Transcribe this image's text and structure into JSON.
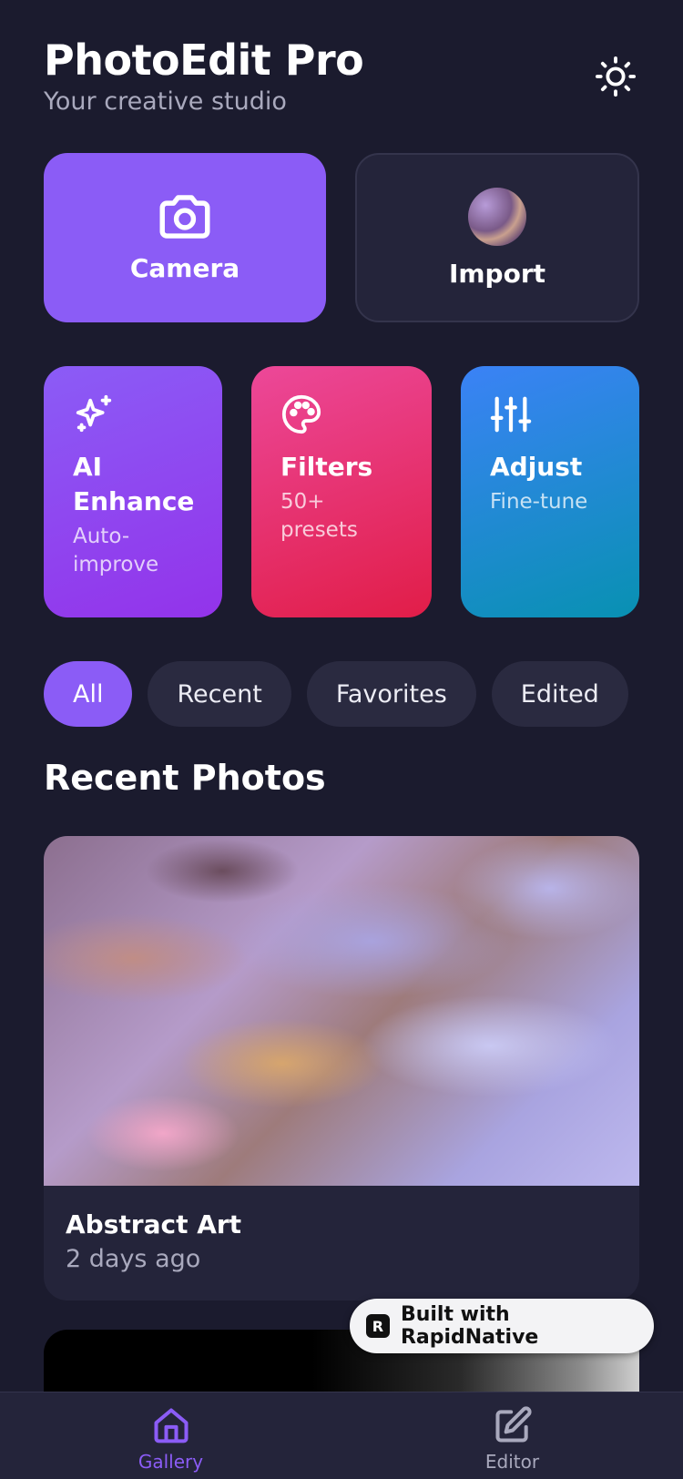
{
  "header": {
    "title": "PhotoEdit Pro",
    "subtitle": "Your creative studio",
    "theme_icon": "sun-icon"
  },
  "primary_actions": [
    {
      "label": "Camera",
      "icon": "camera-icon"
    },
    {
      "label": "Import",
      "icon": "photo-thumbnail"
    }
  ],
  "tools": [
    {
      "title": "AI Enhance",
      "subtitle": "Auto-improve",
      "icon": "sparkles-icon"
    },
    {
      "title": "Filters",
      "subtitle": "50+ presets",
      "icon": "palette-icon"
    },
    {
      "title": "Adjust",
      "subtitle": "Fine-tune",
      "icon": "sliders-icon"
    }
  ],
  "chips": [
    "All",
    "Recent",
    "Favorites",
    "Edited"
  ],
  "section_title": "Recent Photos",
  "photos": [
    {
      "title": "Abstract Art",
      "meta": "2 days ago"
    }
  ],
  "badge": {
    "text": "Built with RapidNative",
    "logo": "R"
  },
  "tabbar": [
    {
      "label": "Gallery",
      "icon": "home-icon",
      "active": true
    },
    {
      "label": "Editor",
      "icon": "edit-icon",
      "active": false
    }
  ],
  "colors": {
    "background": "#1b1b2e",
    "accent": "#8b5cf6",
    "card": "#24243a"
  }
}
